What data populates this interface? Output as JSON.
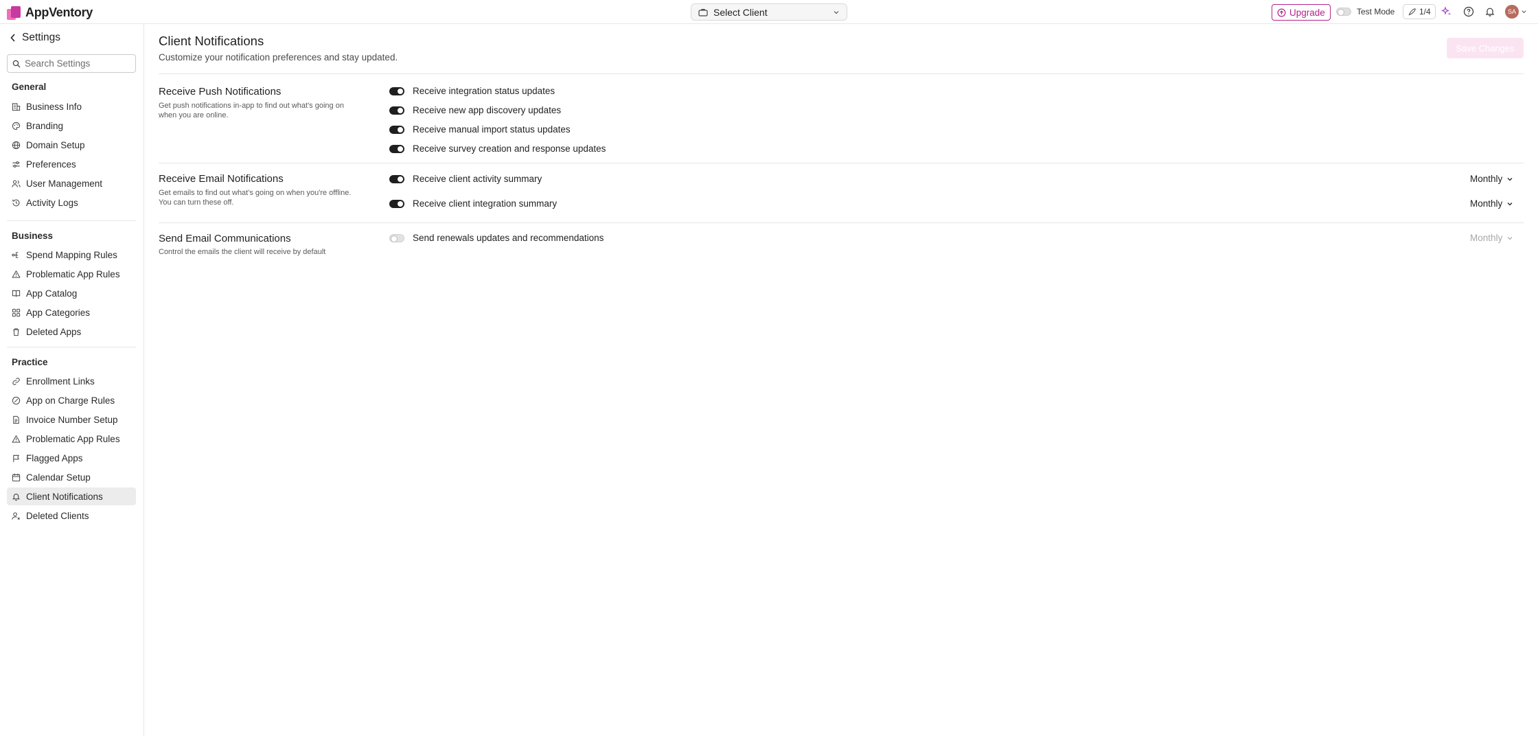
{
  "app": {
    "name": "AppVentory"
  },
  "topbar": {
    "client_select": "Select Client",
    "upgrade_label": "Upgrade",
    "test_mode_label": "Test Mode",
    "progress_label": "1/4",
    "avatar_initials": "SA"
  },
  "sidebar": {
    "back_label": "Settings",
    "search_placeholder": "Search Settings",
    "sections": {
      "general": {
        "title": "General",
        "items": [
          "Business Info",
          "Branding",
          "Domain Setup",
          "Preferences",
          "User Management",
          "Activity Logs"
        ]
      },
      "business": {
        "title": "Business",
        "items": [
          "Spend Mapping Rules",
          "Problematic App Rules",
          "App Catalog",
          "App Categories",
          "Deleted Apps"
        ]
      },
      "practice": {
        "title": "Practice",
        "items": [
          "Enrollment Links",
          "App on Charge Rules",
          "Invoice Number Setup",
          "Problematic App Rules",
          "Flagged Apps",
          "Calendar Setup",
          "Client Notifications",
          "Deleted Clients"
        ],
        "active": "Client Notifications"
      }
    }
  },
  "main": {
    "title": "Client Notifications",
    "subtitle": "Customize your notification preferences and stay updated.",
    "save_label": "Save Changes",
    "groups": [
      {
        "title": "Receive Push Notifications",
        "description": "Get push notifications in-app to find out what's going on when you are online.",
        "options": [
          {
            "label": "Receive integration status updates",
            "enabled": true
          },
          {
            "label": "Receive new app discovery updates",
            "enabled": true
          },
          {
            "label": "Receive manual import status updates",
            "enabled": true
          },
          {
            "label": "Receive survey creation and response updates",
            "enabled": true
          }
        ]
      },
      {
        "title": "Receive Email Notifications",
        "description": "Get emails to find out what's going on when you're offline. You can turn these off.",
        "options": [
          {
            "label": "Receive client activity summary",
            "enabled": true,
            "frequency": "Monthly"
          },
          {
            "label": "Receive client integration summary",
            "enabled": true,
            "frequency": "Monthly"
          }
        ]
      },
      {
        "title": "Send Email Communications",
        "description": "Control the emails the client will receive by default",
        "options": [
          {
            "label": "Send renewals updates and recommendations",
            "enabled": false,
            "frequency": "Monthly"
          }
        ]
      }
    ]
  },
  "colors": {
    "brand": "#b5248c",
    "toggle_on": "#1f1f1f",
    "active_item_bg": "#ececec"
  }
}
